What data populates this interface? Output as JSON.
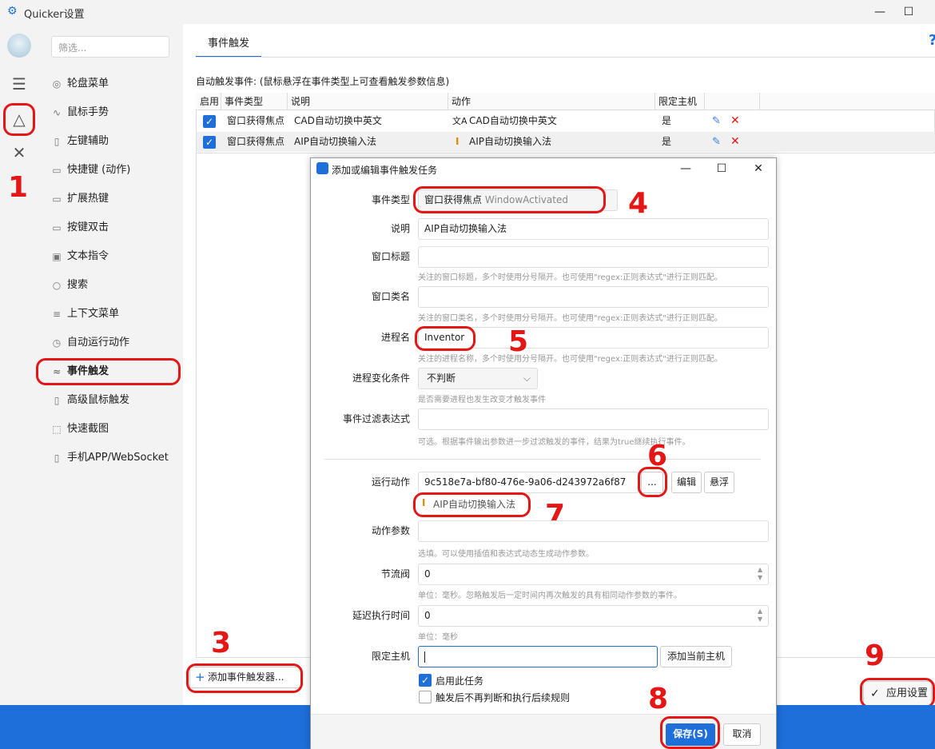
{
  "window": {
    "title": "Quicker设置"
  },
  "filter": {
    "placeholder": "筛选..."
  },
  "nav": [
    {
      "label": "轮盘菜单",
      "icon": "radio-icon"
    },
    {
      "label": "鼠标手势",
      "icon": "gesture-icon"
    },
    {
      "label": "左键辅助",
      "icon": "mouse-icon"
    },
    {
      "label": "快捷键 (动作)",
      "icon": "keyboard-icon"
    },
    {
      "label": "扩展热键",
      "icon": "keyboard-icon"
    },
    {
      "label": "按键双击",
      "icon": "keyboard-icon"
    },
    {
      "label": "文本指令",
      "icon": "text-ad-icon"
    },
    {
      "label": "搜索",
      "icon": "search-icon"
    },
    {
      "label": "上下文菜单",
      "icon": "menu-icon"
    },
    {
      "label": "自动运行动作",
      "icon": "alarm-icon"
    },
    {
      "label": "事件触发",
      "icon": "wind-icon"
    },
    {
      "label": "高级鼠标触发",
      "icon": "mouse-icon"
    },
    {
      "label": "快速截图",
      "icon": "screenshot-icon"
    },
    {
      "label": "手机APP/WebSocket",
      "icon": "phone-icon"
    }
  ],
  "tab": {
    "label": "事件触发"
  },
  "section": {
    "title": "自动触发事件:  (鼠标悬浮在事件类型上可查看触发参数信息)"
  },
  "table": {
    "headers": [
      "启用",
      "事件类型",
      "说明",
      "动作",
      "限定主机"
    ],
    "rows": [
      {
        "event": "窗口获得焦点",
        "desc": "CAD自动切换中英文",
        "action": "CAD自动切换中英文",
        "host": "是"
      },
      {
        "event": "窗口获得焦点",
        "desc": "AIP自动切换输入法",
        "action": "AIP自动切换输入法",
        "host": "是"
      }
    ]
  },
  "buttons": {
    "add_trigger": "添加事件触发器...",
    "apply": "应用设置"
  },
  "dialog": {
    "title": "添加或编辑事件触发任务",
    "event_type_label": "事件类型",
    "event_type_value": "窗口获得焦点",
    "event_type_code": "WindowActivated",
    "desc_label": "说明",
    "desc_value": "AIP自动切换输入法",
    "win_title_label": "窗口标题",
    "win_title_hint": "关注的窗口标题，多个时使用分号隔开。也可使用\"regex:正则表达式\"进行正则匹配。",
    "win_class_label": "窗口类名",
    "win_class_hint": "关注的窗口类名，多个时使用分号隔开。也可使用\"regex:正则表达式\"进行正则匹配。",
    "process_label": "进程名",
    "process_value": "Inventor",
    "process_hint": "关注的进程名称，多个时使用分号隔开。也可使用\"regex:正则表达式\"进行正则匹配。",
    "proc_change_label": "进程变化条件",
    "proc_change_value": "不判断",
    "proc_change_hint": "是否需要进程也发生改变才触发事件",
    "filter_label": "事件过滤表达式",
    "filter_hint": "可选。根据事件输出参数进一步过滤触发的事件，结果为true继续执行事件。",
    "action_label": "运行动作",
    "action_id": "9c518e7a-bf80-476e-9a06-d243972a6f87",
    "action_more": "...",
    "action_edit": "编辑",
    "action_float": "悬浮",
    "action_name": "AIP自动切换输入法",
    "params_label": "动作参数",
    "params_hint": "选填。可以使用插值和表达式动态生成动作参数。",
    "throttle_label": "节流阀",
    "throttle_value": "0",
    "throttle_hint": "单位：毫秒。忽略触发后一定时间内再次触发的具有相同动作参数的事件。",
    "delay_label": "延迟执行时间",
    "delay_value": "0",
    "delay_hint": "单位：毫秒",
    "host_label": "限定主机",
    "add_host": "添加当前主机",
    "enable_task": "启用此任务",
    "no_more_rules": "触发后不再判断和执行后续规则",
    "save": "保存(S)",
    "cancel": "取消"
  },
  "annotations": [
    "1",
    "2",
    "3",
    "4",
    "5",
    "6",
    "7",
    "8",
    "9"
  ],
  "colors": {
    "accent": "#1e6fd9",
    "annotation": "#e41616"
  }
}
